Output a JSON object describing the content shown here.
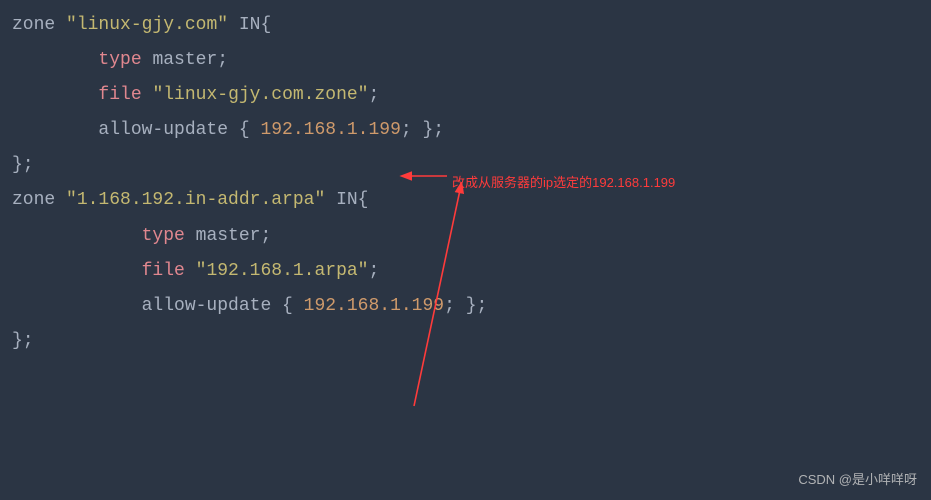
{
  "code": {
    "l1": {
      "a": "zone ",
      "b": "\"linux-gjy.com\"",
      "c": " IN{"
    },
    "l2": {
      "a": "        ",
      "b": "type",
      "c": " master;"
    },
    "l3": {
      "a": "        ",
      "b": "file",
      "c": " ",
      "d": "\"linux-gjy.com.zone\"",
      "e": ";"
    },
    "l4": {
      "a": "        allow-update { ",
      "b": "192.168.1.199",
      "c": "; };"
    },
    "l5": {
      "a": ""
    },
    "l6": {
      "a": "};"
    },
    "l7": {
      "a": "zone ",
      "b": "\"1.168.192.in-addr.arpa\"",
      "c": " IN{"
    },
    "l8": {
      "a": "            ",
      "b": "type",
      "c": " master;"
    },
    "l9": {
      "a": "            ",
      "b": "file",
      "c": " ",
      "d": "\"192.168.1.arpa\"",
      "e": ";"
    },
    "l10": {
      "a": "            allow-update { ",
      "b": "192.168.1.199",
      "c": "; };"
    },
    "l11": {
      "a": ""
    },
    "l12": {
      "a": "};"
    }
  },
  "annotation": {
    "text": "改成从服务器的ip选定的192.168.1.199"
  },
  "watermark": "CSDN @是小咩咩呀"
}
